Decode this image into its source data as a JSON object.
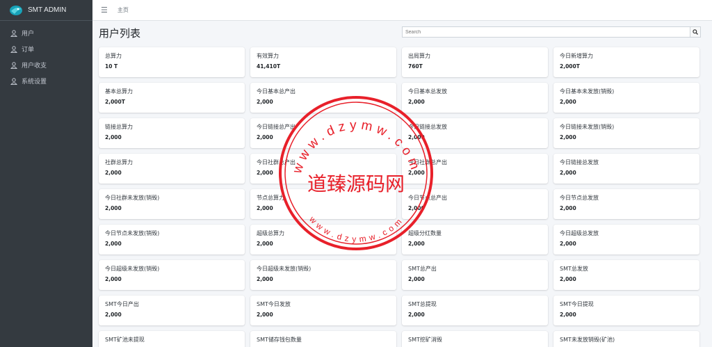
{
  "brand": {
    "name": "SMT ADMIN"
  },
  "sidebar": {
    "items": [
      {
        "label": "用户"
      },
      {
        "label": "订单"
      },
      {
        "label": "用户收支"
      },
      {
        "label": "系统设置"
      }
    ]
  },
  "topbar": {
    "breadcrumb": "主页"
  },
  "page": {
    "title": "用户列表",
    "search_placeholder": "Search"
  },
  "stats": [
    {
      "label": "总算力",
      "value": "10 T"
    },
    {
      "label": "有效算力",
      "value": "41,410T"
    },
    {
      "label": "出局算力",
      "value": "760T"
    },
    {
      "label": "今日新增算力",
      "value": "2,000T"
    },
    {
      "label": "基本总算力",
      "value": "2,000T"
    },
    {
      "label": "今日基本总产出",
      "value": "2,000"
    },
    {
      "label": "今日基本总发放",
      "value": "2,000"
    },
    {
      "label": "今日基本未发放(销毁)",
      "value": "2,000"
    },
    {
      "label": "链接总算力",
      "value": "2,000"
    },
    {
      "label": "今日链接总产出",
      "value": "2,000"
    },
    {
      "label": "今日链接总发放",
      "value": "2,000"
    },
    {
      "label": "今日链接未发放(销毁)",
      "value": "2,000"
    },
    {
      "label": "社群总算力",
      "value": "2,000"
    },
    {
      "label": "今日社群总产出",
      "value": "2,000"
    },
    {
      "label": "今日社群总产出",
      "value": "2,000"
    },
    {
      "label": "今日链接总发放",
      "value": "2,000"
    },
    {
      "label": "今日社群未发放(销毁)",
      "value": "2,000"
    },
    {
      "label": "节点总算力",
      "value": "2,000"
    },
    {
      "label": "今日节点总产出",
      "value": "2,000"
    },
    {
      "label": "今日节点总发放",
      "value": "2,000"
    },
    {
      "label": "今日节点未发放(销毁)",
      "value": "2,000"
    },
    {
      "label": "超级总算力",
      "value": "2,000"
    },
    {
      "label": "超级分红数量",
      "value": "2,000"
    },
    {
      "label": "今日超级总发放",
      "value": "2,000"
    },
    {
      "label": "今日超级未发放(销毁)",
      "value": "2,000"
    },
    {
      "label": "今日超级未发放(销毁)",
      "value": "2,000"
    },
    {
      "label": "SMT总产出",
      "value": "2,000"
    },
    {
      "label": "SMT总发放",
      "value": "2,000"
    },
    {
      "label": "SMT今日产出",
      "value": "2,000"
    },
    {
      "label": "SMT今日发放",
      "value": "2,000"
    },
    {
      "label": "SMT总提现",
      "value": "2,000"
    },
    {
      "label": "SMT今日提现",
      "value": "2,000"
    },
    {
      "label": "SMT矿池未提现",
      "value": ""
    },
    {
      "label": "SMT储存钱包数量",
      "value": ""
    },
    {
      "label": "SMT挖矿消毁",
      "value": ""
    },
    {
      "label": "SMT未发放销毁(矿池)",
      "value": ""
    }
  ],
  "watermark": {
    "center_text": "道臻源码网",
    "ring_text_top": "www.dzymw.com",
    "ring_text_bottom": "www.dzymw.com",
    "color": "#e8202a"
  },
  "colors": {
    "sidebar_bg": "#343a40",
    "content_bg": "#f4f6f9",
    "accent": "#17a2b8"
  }
}
